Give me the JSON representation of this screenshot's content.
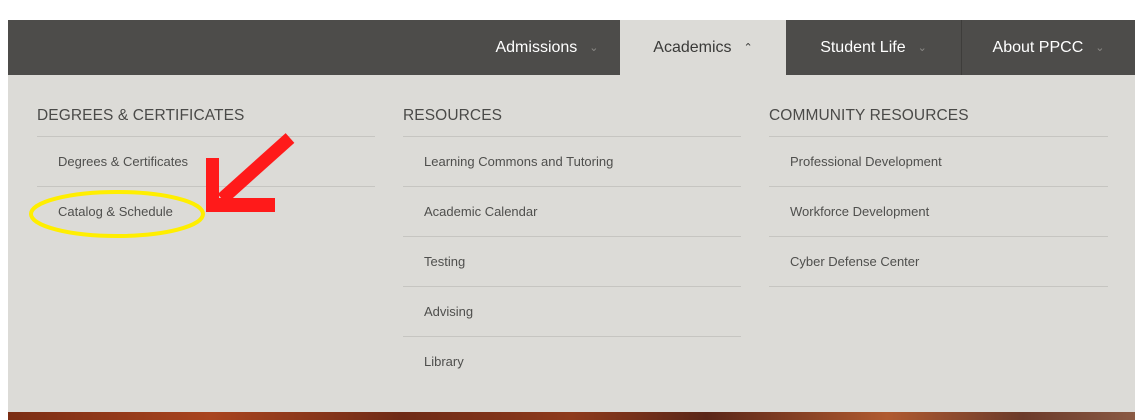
{
  "nav": {
    "items": [
      {
        "label": "Admissions",
        "chevron": "chevron-down-icon"
      },
      {
        "label": "Academics",
        "chevron": "chevron-up-icon"
      },
      {
        "label": "Student Life",
        "chevron": "chevron-down-icon"
      },
      {
        "label": "About PPCC",
        "chevron": "chevron-down-icon"
      }
    ]
  },
  "menu": {
    "columns": [
      {
        "heading": "DEGREES & CERTIFICATES",
        "items": [
          "Degrees & Certificates",
          "Catalog & Schedule"
        ]
      },
      {
        "heading": "RESOURCES",
        "items": [
          "Learning Commons and Tutoring",
          "Academic Calendar",
          "Testing",
          "Advising",
          "Library"
        ]
      },
      {
        "heading": "COMMUNITY RESOURCES",
        "items": [
          "Professional Development",
          "Workforce Development",
          "Cyber Defense Center"
        ]
      }
    ]
  },
  "colors": {
    "nav_bg": "#4d4c4a",
    "panel_bg": "#dcdbd7",
    "annotation_arrow": "#ff1a1a",
    "annotation_circle": "#ffee00"
  }
}
